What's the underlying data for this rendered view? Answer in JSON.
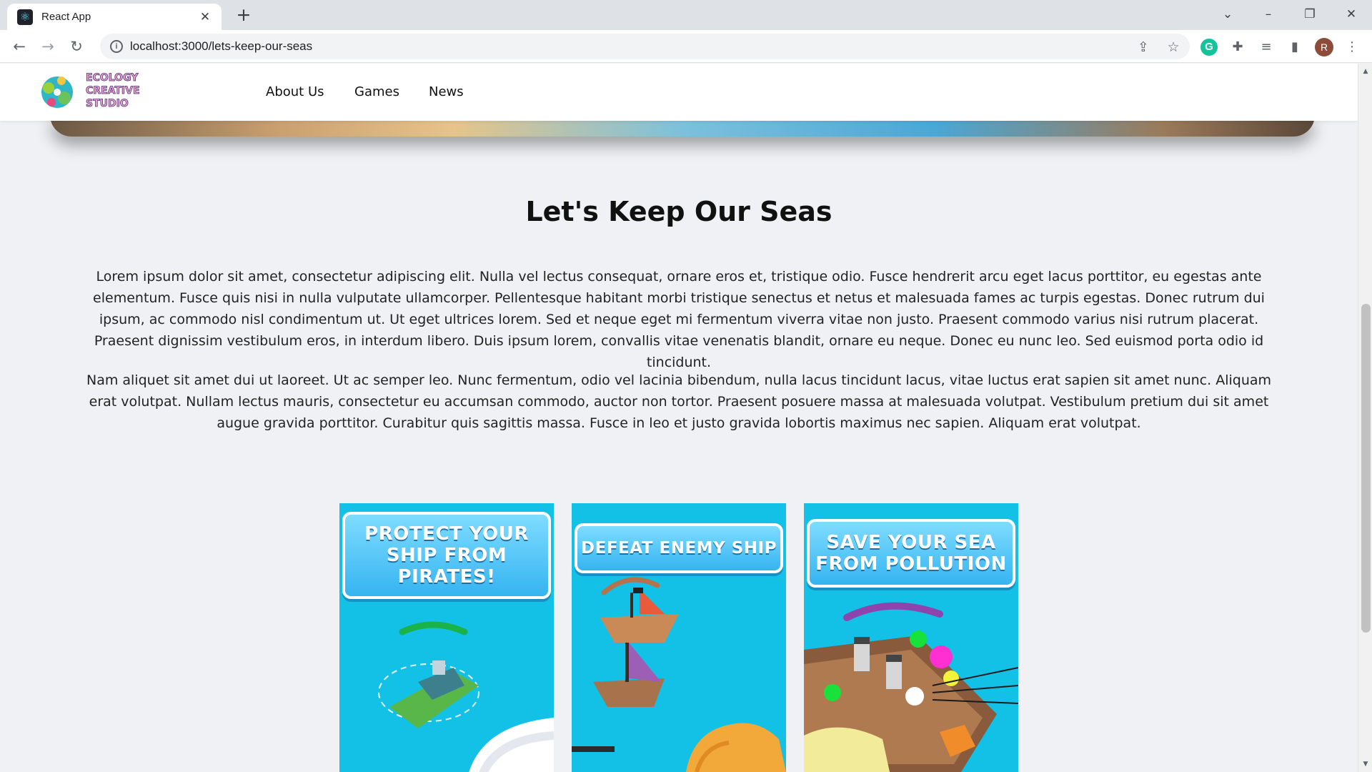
{
  "browser": {
    "tab_title": "React App",
    "url": "localhost:3000/lets-keep-our-seas",
    "profile_initial": "R"
  },
  "site": {
    "logo_text": [
      "ECOLOGY",
      "CREATIVE",
      "STUDIO"
    ],
    "nav": [
      "About Us",
      "Games",
      "News"
    ]
  },
  "page": {
    "title": "Let's Keep Our Seas",
    "paragraphs": [
      "Lorem ipsum dolor sit amet, consectetur adipiscing elit. Nulla vel lectus consequat, ornare eros et, tristique odio. Fusce hendrerit arcu eget lacus porttitor, eu egestas ante elementum. Fusce quis nisi in nulla vulputate ullamcorper. Pellentesque habitant morbi tristique senectus et netus et malesuada fames ac turpis egestas. Donec rutrum dui ipsum, ac commodo nisl condimentum ut. Ut eget ultrices lorem. Sed et neque eget mi fermentum viverra vitae non justo. Praesent commodo varius nisi rutrum placerat. Praesent dignissim vestibulum eros, in interdum libero. Duis ipsum lorem, convallis vitae venenatis blandit, ornare eu neque. Donec eu nunc leo. Sed euismod porta odio id tincidunt.",
      "Nam aliquet sit amet dui ut laoreet. Ut ac semper leo. Nunc fermentum, odio vel lacinia bibendum, nulla lacus tincidunt lacus, vitae luctus erat sapien sit amet nunc. Aliquam erat volutpat. Nullam lectus mauris, consectetur eu accumsan commodo, auctor non tortor. Praesent posuere massa at malesuada volutpat. Vestibulum pretium dui sit amet augue gravida porttitor. Curabitur quis sagittis massa. Fusce in leo et justo gravida lobortis maximus nec sapien. Aliquam erat volutpat."
    ],
    "cards": [
      {
        "banner": "PROTECT YOUR SHIP FROM PIRATES!"
      },
      {
        "banner": "DEFEAT ENEMY SHIP"
      },
      {
        "banner": "SAVE YOUR SEA FROM POLLUTION"
      }
    ]
  },
  "colors": {
    "card_bg": "#13c1e6",
    "banner_blue": "#35b4f0",
    "grammarly": "#15c39a"
  }
}
